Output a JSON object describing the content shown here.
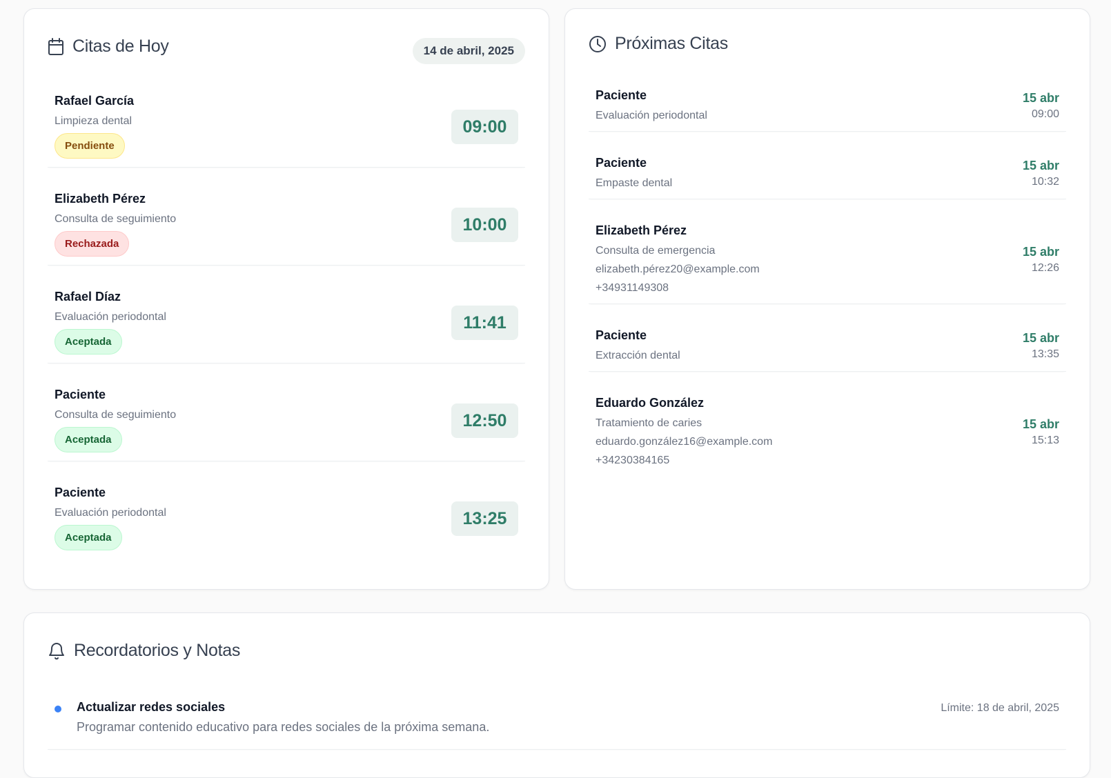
{
  "today": {
    "title": "Citas de Hoy",
    "date": "14 de abril, 2025",
    "appointments": [
      {
        "name": "Rafael García",
        "procedure": "Limpieza dental",
        "status": "Pendiente",
        "time": "09:00"
      },
      {
        "name": "Elizabeth Pérez",
        "procedure": "Consulta de seguimiento",
        "status": "Rechazada",
        "time": "10:00"
      },
      {
        "name": "Rafael Díaz",
        "procedure": "Evaluación periodontal",
        "status": "Aceptada",
        "time": "11:41"
      },
      {
        "name": "Paciente",
        "procedure": "Consulta de seguimiento",
        "status": "Aceptada",
        "time": "12:50"
      },
      {
        "name": "Paciente",
        "procedure": "Evaluación periodontal",
        "status": "Aceptada",
        "time": "13:25"
      }
    ]
  },
  "upcoming": {
    "title": "Próximas Citas",
    "items": [
      {
        "name": "Paciente",
        "procedure": "Evaluación periodontal",
        "day": "15 abr",
        "time": "09:00"
      },
      {
        "name": "Paciente",
        "procedure": "Empaste dental",
        "day": "15 abr",
        "time": "10:32"
      },
      {
        "name": "Elizabeth Pérez",
        "procedure": "Consulta de emergencia",
        "email": "elizabeth.pérez20@example.com",
        "phone": "+34931149308",
        "day": "15 abr",
        "time": "12:26"
      },
      {
        "name": "Paciente",
        "procedure": "Extracción dental",
        "day": "15 abr",
        "time": "13:35"
      },
      {
        "name": "Eduardo González",
        "procedure": "Tratamiento de caries",
        "email": "eduardo.gonzález16@example.com",
        "phone": "+34230384165",
        "day": "15 abr",
        "time": "15:13"
      }
    ]
  },
  "reminders": {
    "title": "Recordatorios y Notas",
    "items": [
      {
        "title": "Actualizar redes sociales",
        "description": "Programar contenido educativo para redes sociales de la próxima semana.",
        "deadline": "Límite: 18 de abril, 2025"
      }
    ]
  },
  "icons": {
    "today": "calendar-icon",
    "upcoming": "clock-icon",
    "reminders": "bell-icon"
  },
  "colors": {
    "accent": "#2f7d68",
    "pending": "#fef9c3",
    "rejected": "#fee2e2",
    "accepted": "#dcfce7",
    "reminder_dot": "#3b82f6"
  }
}
